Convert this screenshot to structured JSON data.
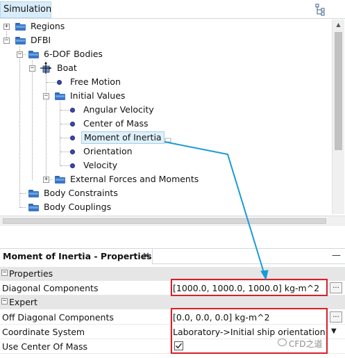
{
  "tree": {
    "tab_label": "Simulation",
    "items": [
      {
        "label": "Regions"
      },
      {
        "label": "DFBI"
      },
      {
        "label": "6-DOF Bodies"
      },
      {
        "label": "Boat"
      },
      {
        "label": "Free Motion"
      },
      {
        "label": "Initial Values"
      },
      {
        "label": "Angular Velocity"
      },
      {
        "label": "Center of Mass"
      },
      {
        "label": "Moment of Inertia"
      },
      {
        "label": "Orientation"
      },
      {
        "label": "Velocity"
      },
      {
        "label": "External Forces and Moments"
      },
      {
        "label": "Body Constraints"
      },
      {
        "label": "Body Couplings"
      }
    ]
  },
  "properties": {
    "tab_label": "Moment of Inertia - Properties",
    "close_glyph": "✕",
    "minimize_glyph": "—",
    "categories": [
      {
        "label": "Properties"
      },
      {
        "label": "Expert"
      }
    ],
    "rows": [
      {
        "name": "Diagonal Components",
        "value": "[1000.0, 1000.0, 1000.0] kg-m^2",
        "button": "..."
      },
      {
        "name": "Off Diagonal Components",
        "value": "[0.0, 0.0, 0.0] kg-m^2",
        "button": "..."
      },
      {
        "name": "Coordinate System",
        "value": "Laboratory->Initial ship orientation"
      },
      {
        "name": "Use Center Of Mass",
        "checked": true
      }
    ]
  },
  "annotation_color": "#d6202a",
  "arrow_color": "#1a9ad6",
  "watermark": "CFD之道"
}
